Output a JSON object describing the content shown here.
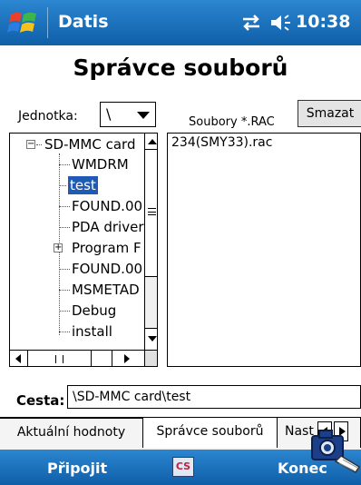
{
  "titlebar": {
    "app_name": "Datis",
    "time": "10:38",
    "start_icon": "windows-flag-icon",
    "connectivity_icon": "connectivity-arrows-icon",
    "volume_icon": "speaker-icon"
  },
  "heading": "Správce souborů",
  "drive": {
    "label": "Jednotka:",
    "value": "\\"
  },
  "files": {
    "label": "Soubory *.RAC",
    "delete_button": "Smazat",
    "items": [
      "234(SMY33).rac"
    ]
  },
  "tree": {
    "root": "SD-MMC card",
    "items": [
      "WMDRM",
      "test",
      "FOUND.00",
      "PDA driver",
      "Program F",
      "FOUND.00",
      "MSMETAD",
      "Debug",
      "install"
    ],
    "selected": "test"
  },
  "path": {
    "label": "Cesta:",
    "value": "\\SD-MMC card\\test"
  },
  "tabs": [
    "Aktuální hodnoty",
    "Správce souborů",
    "Nast"
  ],
  "menu": {
    "left": "Připojit",
    "right": "Konec",
    "ime": "CS"
  },
  "colors": {
    "titlebar": "#1a6fbf",
    "selection": "#1f5ab4"
  }
}
